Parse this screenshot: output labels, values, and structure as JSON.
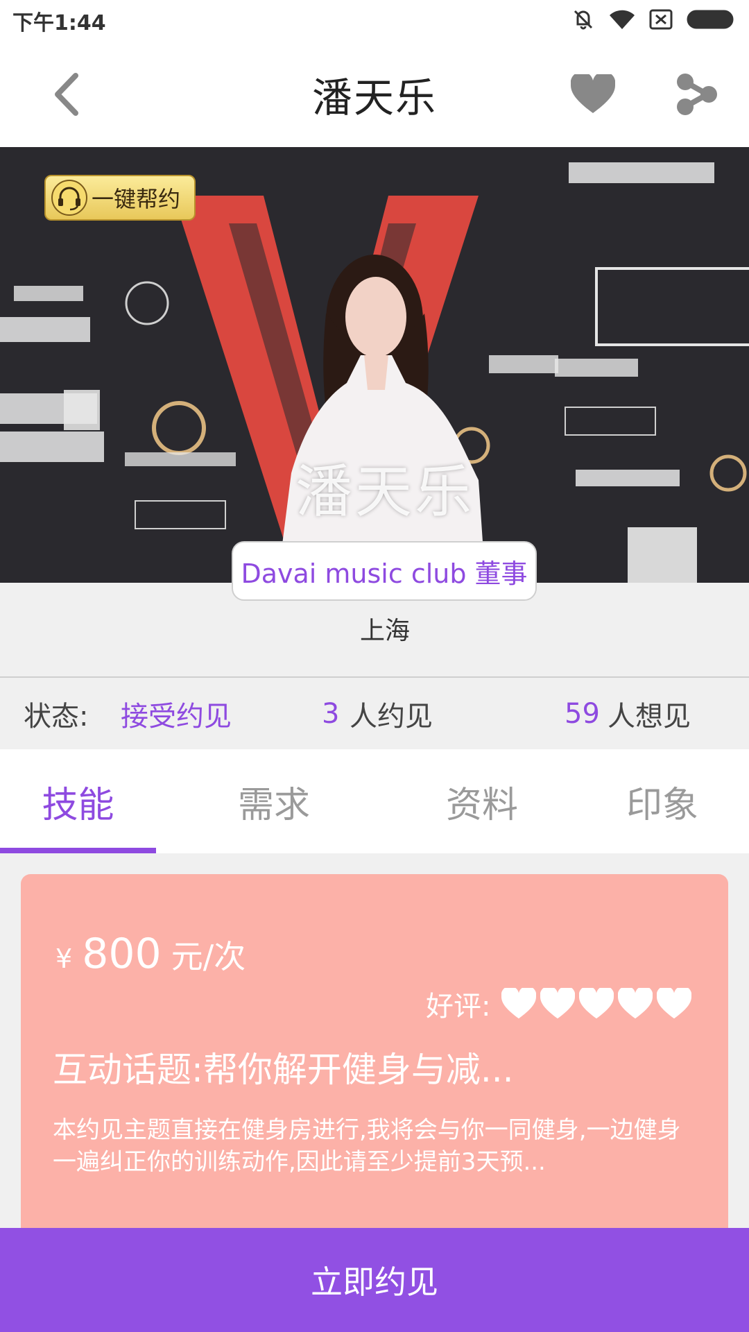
{
  "status_bar": {
    "time": "下午1:44"
  },
  "header": {
    "title": "潘天乐"
  },
  "hero": {
    "help_button_label": "一键帮约",
    "name_overlay": "潘天乐"
  },
  "profile": {
    "title": "Davai music club 董事",
    "city": "上海"
  },
  "stats": {
    "status_label": "状态:",
    "status_value": "接受约见",
    "met_count": "3",
    "met_text": "人约见",
    "want_count": "59",
    "want_text": "人想见"
  },
  "tabs": [
    {
      "label": "技能"
    },
    {
      "label": "需求"
    },
    {
      "label": "资料"
    },
    {
      "label": "印象"
    }
  ],
  "skill_card": {
    "currency": "¥",
    "amount": "800",
    "unit": "元/次",
    "rating_label": "好评:",
    "rating_hearts": 5,
    "topic": "互动话题:帮你解开健身与减...",
    "description": "本约见主题直接在健身房进行,我将会与你一同健身,一边健身一遍纠正你的训练动作,因此请至少提前3天预..."
  },
  "cta": {
    "label": "立即约见"
  },
  "colors": {
    "accent": "#8e4ae0",
    "cta_bg": "#9150e3",
    "card_bg": "#fcb1a8"
  }
}
